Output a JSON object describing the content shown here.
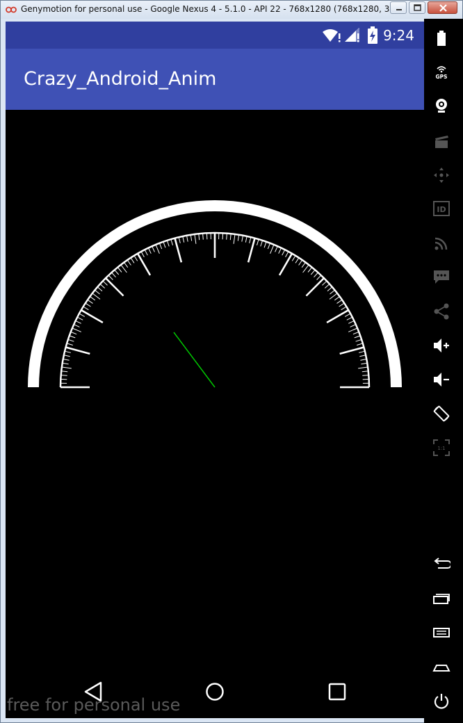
{
  "window": {
    "title": "Genymotion for personal use - Google Nexus 4 - 5.1.0 - API 22 - 768x1280 (768x1280, 32..."
  },
  "status_bar": {
    "time": "9:24"
  },
  "app_bar": {
    "title": "Crazy_Android_Anim"
  },
  "gauge": {
    "ticks_major": 13,
    "minor_per_major": 10,
    "needle_color": "#00c800"
  },
  "nav_bar": {
    "icons": [
      "back-icon",
      "home-icon",
      "recents-icon"
    ]
  },
  "watermark": {
    "text": "free for personal use"
  },
  "toolbar": {
    "gps_label": "GPS",
    "id_label": "ID",
    "items": [
      "battery-icon",
      "gps-icon",
      "webcam-icon",
      "capture-icon",
      "remote-control-icon",
      "identifiers-icon",
      "rss-icon",
      "sms-icon",
      "share-icon",
      "volume-up-icon",
      "volume-down-icon",
      "rotate-icon",
      "scale-icon",
      "back-icon",
      "recent-apps-icon",
      "menu-icon",
      "home-icon",
      "power-icon"
    ]
  },
  "colors": {
    "status_bar": "#303f9f",
    "app_bar": "#3f51b5",
    "screen_bg": "#000000"
  }
}
